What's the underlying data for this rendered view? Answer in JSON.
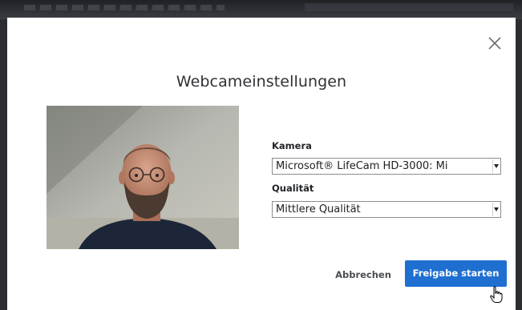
{
  "dialog": {
    "title": "Webcameinstellungen",
    "close_icon": "close-icon"
  },
  "camera": {
    "label": "Kamera",
    "selected": "Microsoft® LifeCam HD-3000: Mi"
  },
  "quality": {
    "label": "Qualität",
    "selected": "Mittlere Qualität"
  },
  "actions": {
    "cancel_label": "Abbrechen",
    "start_label": "Freigabe starten"
  },
  "colors": {
    "primary_button": "#1f6fd1",
    "backdrop": "#2b2d31",
    "dialog_bg": "#ffffff"
  },
  "cursor_icon": "hand-pointer-icon"
}
